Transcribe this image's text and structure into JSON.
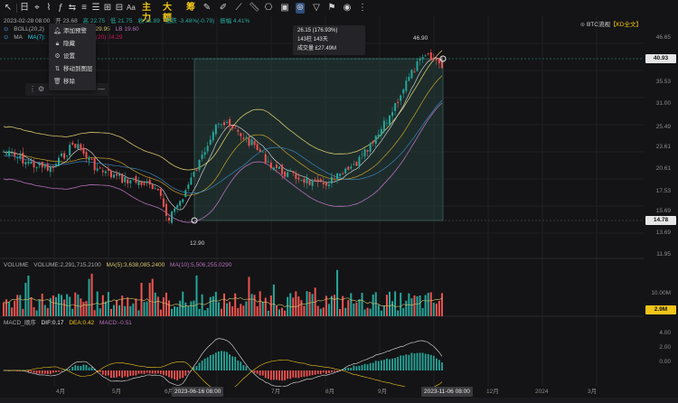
{
  "toolbar": {
    "timeframe_label": "日",
    "zhuli_label": "主力",
    "dadan_label": "大额",
    "chou_label": "筹",
    "text_tool": "Aa",
    "icons": [
      "cursor-icon",
      "crosshair-icon",
      "line-icon",
      "menu-icon",
      "fibonacci-icon",
      "text-icon",
      "brush-icon",
      "ruler-icon",
      "magnet-icon",
      "measure-icon",
      "settings-icon",
      "filter-icon",
      "bell-icon",
      "eye-icon"
    ]
  },
  "info_line1": {
    "date": "2023-02-28 08:00",
    "open": "开 23.68",
    "high": "高 22.75",
    "low": "低 21.75",
    "close": "收 21.89",
    "change": "涨跌 -3.48%(-0.79)",
    "amplitude": "振幅 4.41%"
  },
  "info_line2": {
    "label": "BOLL(20,2)",
    "ub": "UB 29.95",
    "lb": "LB 19.60"
  },
  "info_line3": {
    "label": "MA",
    "ma7": "MA(7):",
    "ma20": "MA(20):24.29"
  },
  "context_menu": {
    "items": [
      {
        "icon": "bell-icon",
        "label": "添加预警"
      },
      {
        "icon": "lock-icon",
        "label": "隐藏"
      },
      {
        "icon": "gear-icon",
        "label": "设置"
      },
      {
        "icon": "move-icon",
        "label": "移动到图层"
      },
      {
        "icon": "trash-icon",
        "label": "移除"
      }
    ]
  },
  "tooltip": {
    "line1": "26.15 (176.93%)",
    "line2": "143柱 143天",
    "line3": "成交量 £27.49M"
  },
  "legend": {
    "symbol": "BTC流视",
    "tag": "【KD全文】"
  },
  "price_axis": {
    "ticks": [
      "46.65",
      "35.53",
      "31.00",
      "25.49",
      "23.61",
      "20.61",
      "17.53",
      "15.69",
      "13.69",
      "11.95"
    ],
    "current_price": "40.93",
    "low_price": "14.78",
    "peak_label": "46.90",
    "low_label": "12.90"
  },
  "volume": {
    "label": "VOLUME",
    "vol": "VOLUME:2,291,715.2100",
    "ma5": "MA(5):3,638,085.2400",
    "ma10": "MA(10):5,506,255.0290",
    "axis_tick": "10.00M",
    "current": "2.9M"
  },
  "macd": {
    "label": "MACD_顺序",
    "dif": "DIF:0.17",
    "dea": "DEA:0.42",
    "macd": "MACD:-0.51",
    "ticks": [
      "4.00",
      "2.00",
      "0.00"
    ]
  },
  "xaxis": {
    "labels": [
      "4月",
      "5月",
      "6月",
      "7月",
      "8月",
      "9月",
      "10月",
      "12月",
      "2024",
      "3月"
    ],
    "sel_start": "2023-06-16 08:00",
    "sel_end": "2023-11-06 08:00"
  },
  "colors": {
    "up": "#26a69a",
    "down": "#ef5350",
    "accent": "#f0c419",
    "boll_mid": "#c9a227",
    "boll_up": "#d4c36a",
    "boll_dn": "#b46fb9"
  },
  "chart_data": {
    "type": "candlestick",
    "note_range": [
      13.0,
      46.9
    ]
  }
}
